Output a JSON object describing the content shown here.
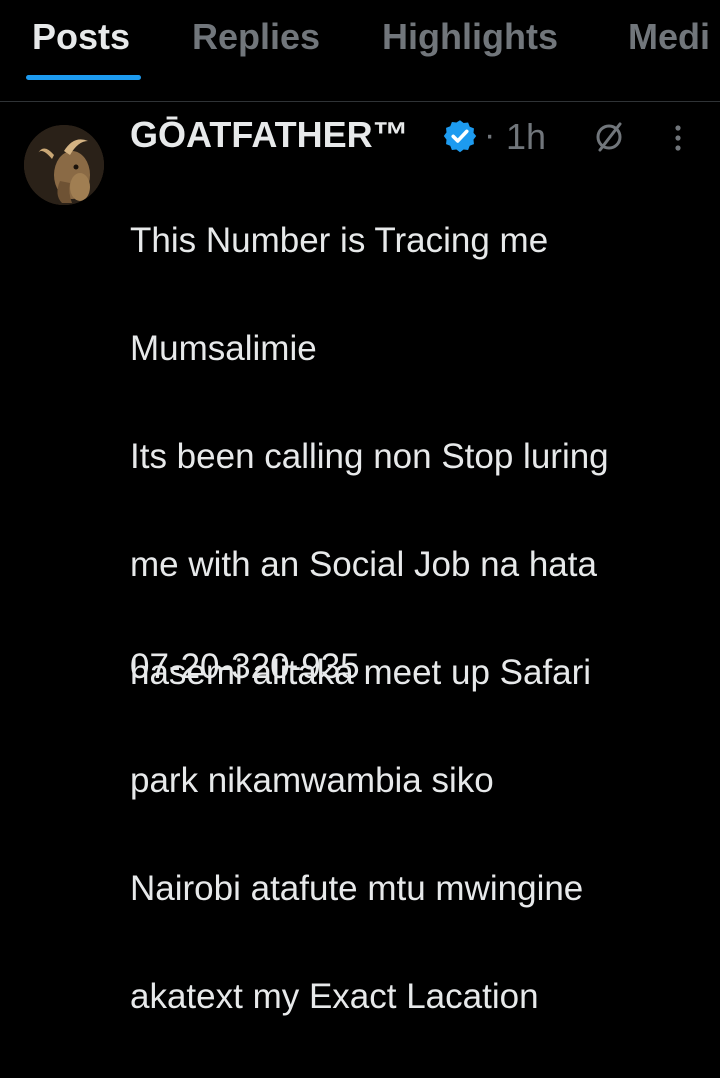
{
  "tabs": [
    {
      "label": "Posts",
      "active": true
    },
    {
      "label": "Replies",
      "active": false
    },
    {
      "label": "Highlights",
      "active": false
    },
    {
      "label": "Medi",
      "active": false
    }
  ],
  "post": {
    "author_name": "GŌATFATHER™",
    "verified": true,
    "separator": "·",
    "time": "1h",
    "lines": [
      "This Number is Tracing me",
      "Mumsalimie",
      "Its been calling non Stop luring",
      "me with an Social Job na hata",
      "hasemi alitaka meet up Safari",
      "park nikamwambia siko",
      "Nairobi atafute mtu mwingine",
      "akatext my Exact Lacation"
    ],
    "phone_number": "07-20-320-935"
  },
  "icons": {
    "verified": "verified-badge-icon",
    "grok": "grok-icon",
    "more": "more-options-icon"
  },
  "colors": {
    "background": "#000000",
    "accent": "#1d9bf0",
    "text": "#e7e9ea",
    "muted": "#71767b"
  }
}
